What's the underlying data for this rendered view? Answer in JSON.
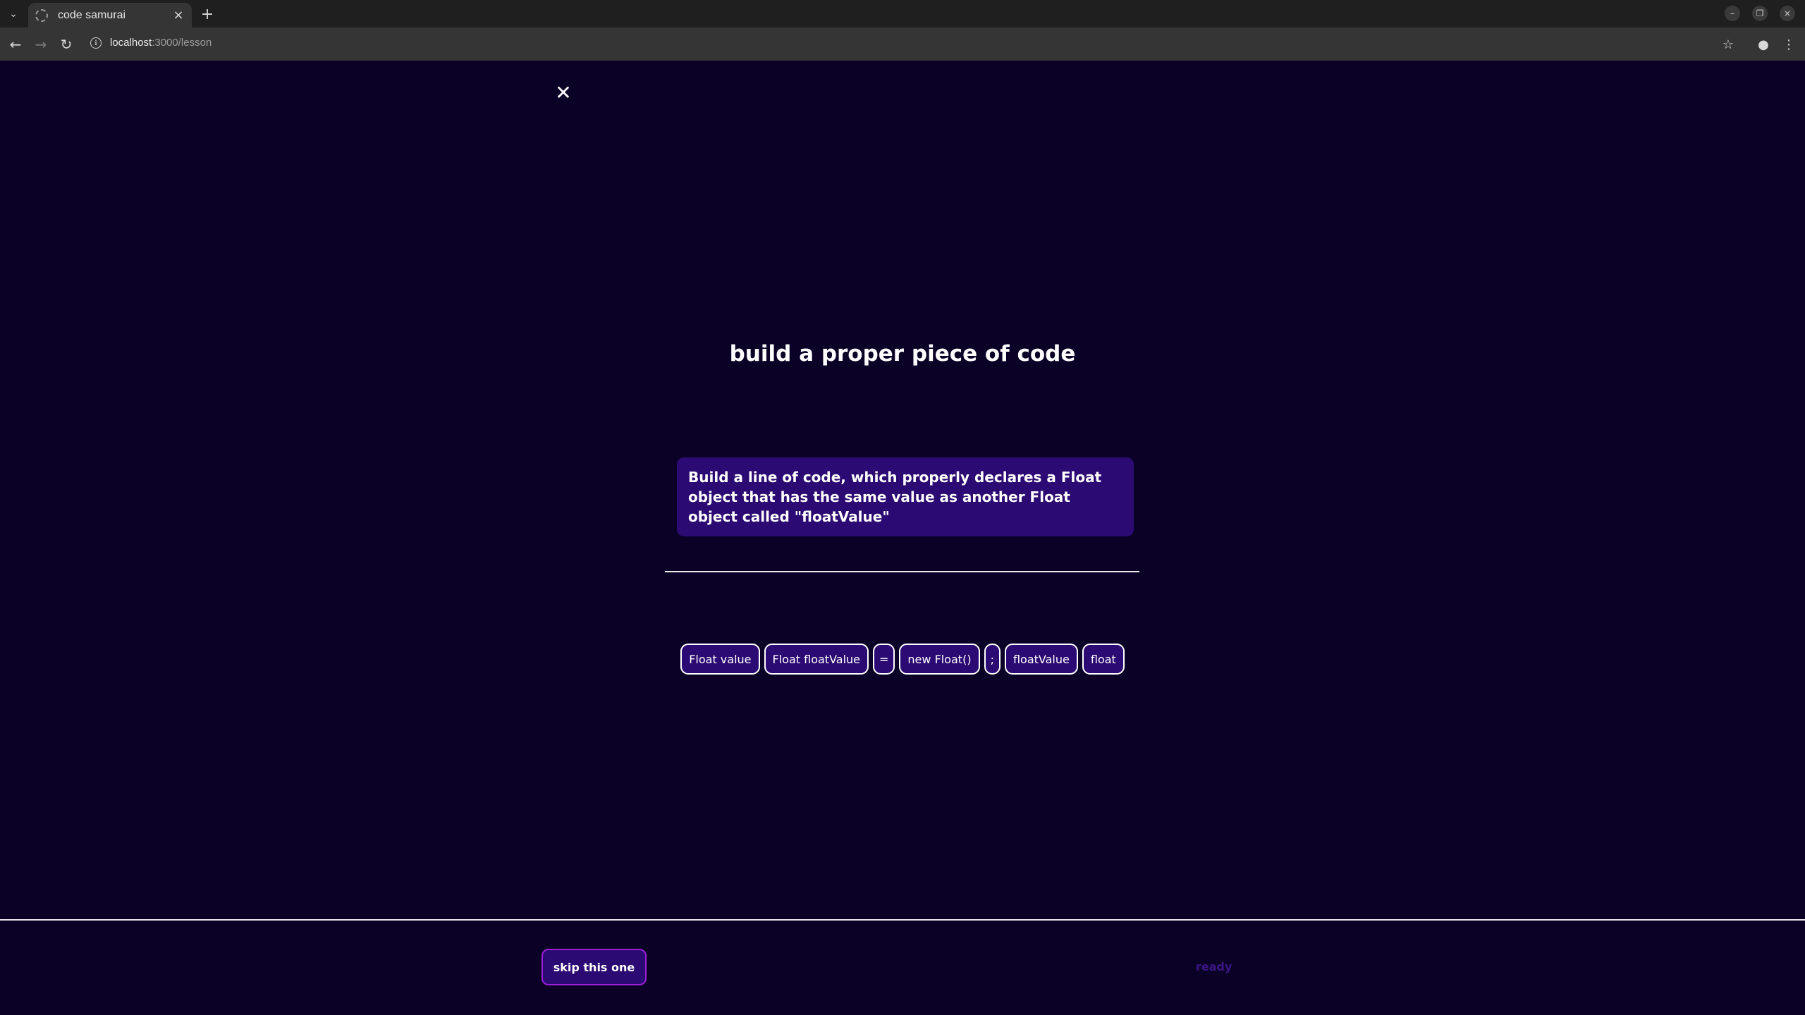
{
  "browser": {
    "tab_title": "code samurai",
    "url_host": "localhost",
    "url_path": ":3000/lesson"
  },
  "lesson": {
    "heading": "build a proper piece of code",
    "prompt": "Build a line of code, which properly declares a Float object that has the same value as another Float object called \"floatValue\"",
    "chips": [
      "Float value",
      "Float floatValue",
      "=",
      "new Float()",
      ";",
      "floatValue",
      "float"
    ],
    "skip_label": "skip this one",
    "status": "ready"
  },
  "colors": {
    "background": "#0b0127",
    "accent": "#2c0a73",
    "skip_border": "#9a1fd6",
    "status_text": "#3b1585"
  }
}
